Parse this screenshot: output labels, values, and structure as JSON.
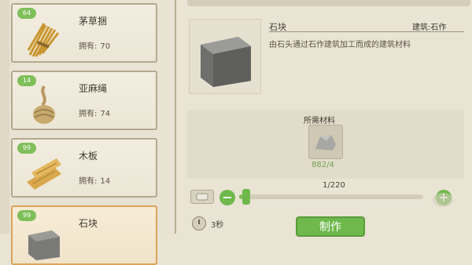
{
  "recipes": [
    {
      "level": "64",
      "name": "茅草捆",
      "own_label": "拥有:",
      "own_value": "70",
      "icon": "thatch-bundle-icon"
    },
    {
      "level": "14",
      "name": "亚麻绳",
      "own_label": "拥有:",
      "own_value": "74",
      "icon": "flax-rope-icon"
    },
    {
      "level": "99",
      "name": "木板",
      "own_label": "拥有:",
      "own_value": "14",
      "icon": "wood-plank-icon"
    },
    {
      "level": "99",
      "name": "石块",
      "own_label": "",
      "own_value": "",
      "icon": "stone-block-icon"
    }
  ],
  "detail": {
    "name": "石块",
    "type": "建筑:石作",
    "description": "由石头通过石作建筑加工而成的建筑材料",
    "materials_label": "所需材料",
    "material_count": "882/4",
    "material_icon": "stone-icon",
    "quantity_text": "1/220",
    "quantity": 1,
    "quantity_max": 220,
    "time_text": "3秒",
    "craft_label": "制作"
  },
  "colors": {
    "accent": "#6fb94c",
    "selected": "#d9a45b",
    "background": "#e9e4d4"
  }
}
